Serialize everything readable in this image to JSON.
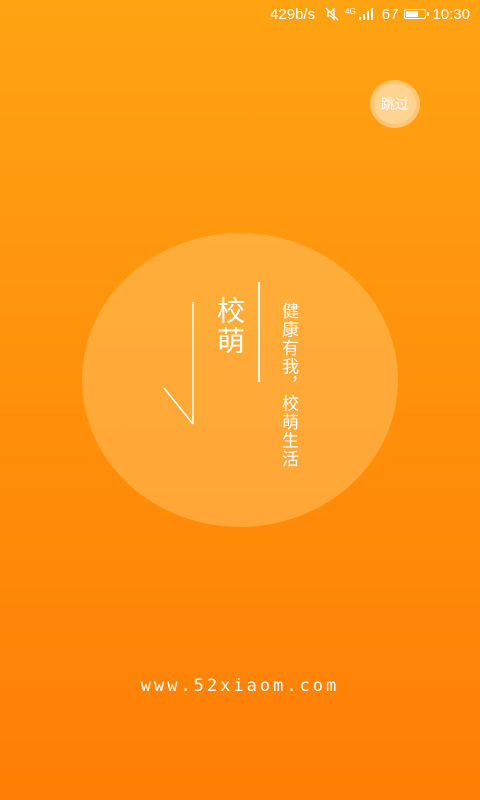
{
  "status_bar": {
    "net_speed": "429b/s",
    "net_type": "4G",
    "battery_level": "67",
    "battery_fraction": 0.67,
    "time": "10:30",
    "icons": [
      "mute-icon",
      "signal-icon",
      "battery-icon"
    ]
  },
  "skip_button": {
    "label": "跳过"
  },
  "brand": {
    "title": "校萌",
    "slogan": "健康有我，校萌生活"
  },
  "footer": {
    "website": "www.52xiaom.com"
  },
  "colors": {
    "background_top": "#ffa313",
    "background_bottom": "#ff7e05",
    "text": "#ffffff"
  }
}
